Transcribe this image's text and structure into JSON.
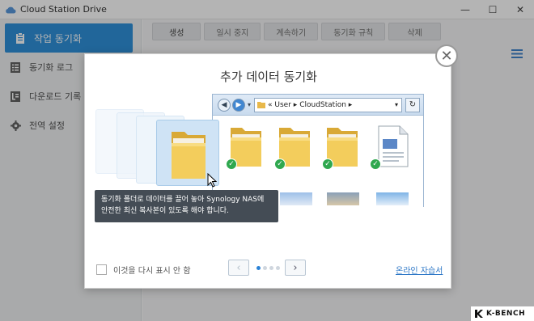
{
  "window": {
    "title": "Cloud Station Drive",
    "controls": [
      "minimize",
      "maximize",
      "close"
    ]
  },
  "sidebar": {
    "items": [
      {
        "label": "작업 동기화",
        "icon": "clipboard-icon",
        "active": true
      },
      {
        "label": "동기화 로그",
        "icon": "list-icon",
        "active": false
      },
      {
        "label": "다운로드 기록",
        "icon": "download-log-icon",
        "active": false
      },
      {
        "label": "전역 설정",
        "icon": "gear-icon",
        "active": false
      }
    ]
  },
  "toolbar": {
    "create": "생성",
    "pause": "일시 중지",
    "resume": "계속하기",
    "sync_rules": "동기화 규칙",
    "delete": "삭제"
  },
  "dialog": {
    "title": "추가 데이터 동기화",
    "explorer": {
      "breadcrumb_prefix": "«",
      "path_1": "User",
      "path_2": "CloudStation",
      "path_sep": "▸"
    },
    "tooltip": {
      "line1": "동기화 폴더로 데이터를 끌어 놓아 Synology NAS에",
      "line2": "안전한 최신 복사본이 있도록 해야 합니다."
    },
    "dont_show": "이것을 다시 표시 안 함",
    "tutorial_link": "온라인 자습서",
    "pager": {
      "current": 1,
      "total": 4
    }
  },
  "watermark": {
    "text": "K-BENCH"
  },
  "colors": {
    "accent": "#1e88d8",
    "check": "#2fa84f",
    "link": "#2e78c7"
  }
}
